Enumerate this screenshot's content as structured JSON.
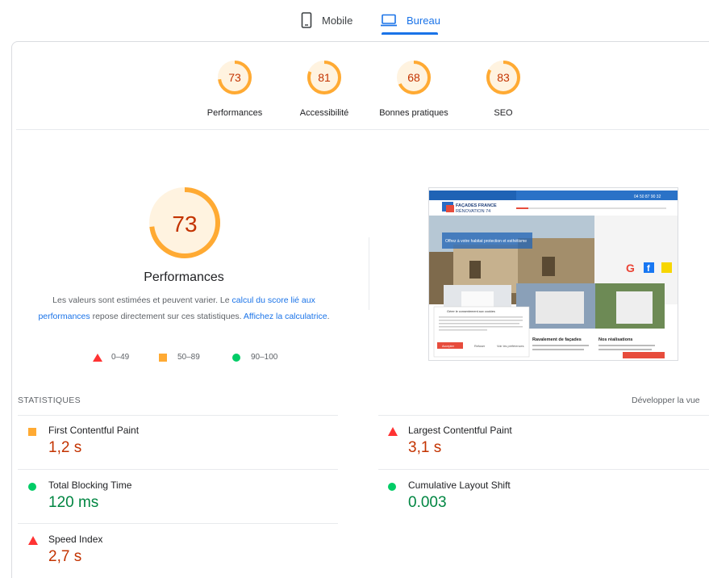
{
  "tabs": [
    {
      "label": "Mobile",
      "icon": "phone-icon",
      "active": false
    },
    {
      "label": "Bureau",
      "icon": "laptop-icon",
      "active": true
    }
  ],
  "gauges": [
    {
      "score": "73",
      "label": "Performances",
      "fraction": 0.73
    },
    {
      "score": "81",
      "label": "Accessibilité",
      "fraction": 0.81
    },
    {
      "score": "68",
      "label": "Bonnes pratiques",
      "fraction": 0.68
    },
    {
      "score": "83",
      "label": "SEO",
      "fraction": 0.83
    }
  ],
  "colors": {
    "average": "#fa3",
    "average_bg": "#fff3e0",
    "fail": "#f33",
    "pass": "#0c6",
    "link": "#1a73e8",
    "score_text": "#c33300"
  },
  "main": {
    "score": "73",
    "fraction": 0.73,
    "title": "Performances",
    "desc_part1": "Les valeurs sont estimées et peuvent varier. Le ",
    "desc_link1": "calcul du score lié aux performances",
    "desc_part2": " repose directement sur ces statistiques. ",
    "desc_link2": "Affichez la calculatrice",
    "desc_part3": "."
  },
  "legend": [
    {
      "range": "0–49",
      "shape": "triangle",
      "color": "#f33"
    },
    {
      "range": "50–89",
      "shape": "square",
      "color": "#fa3"
    },
    {
      "range": "90–100",
      "shape": "circle",
      "color": "#0c6"
    }
  ],
  "thumbnail": {
    "logo_line1": "FAÇADES FRANCE",
    "logo_line2": "RÉNOVATION 74",
    "phone": "04 50 87 90 32",
    "hero_text": "Offrez à votre habitat protection et esthétisme",
    "section1": "Ravalement de façades",
    "section2": "Nos réalisations",
    "cookie_title": "Gérer le consentement aux cookies",
    "cookie_accept": "Accepter",
    "cookie_refuse": "Refuser",
    "cookie_prefs": "Voir les préférences"
  },
  "stats": {
    "header": "STATISTIQUES",
    "expand": "Développer la vue",
    "metrics": [
      {
        "name": "First Contentful Paint",
        "value": "1,2 s",
        "rating": "average"
      },
      {
        "name": "Largest Contentful Paint",
        "value": "3,1 s",
        "rating": "fail"
      },
      {
        "name": "Total Blocking Time",
        "value": "120 ms",
        "rating": "pass"
      },
      {
        "name": "Cumulative Layout Shift",
        "value": "0.003",
        "rating": "pass"
      },
      {
        "name": "Speed Index",
        "value": "2,7 s",
        "rating": "fail"
      }
    ]
  }
}
